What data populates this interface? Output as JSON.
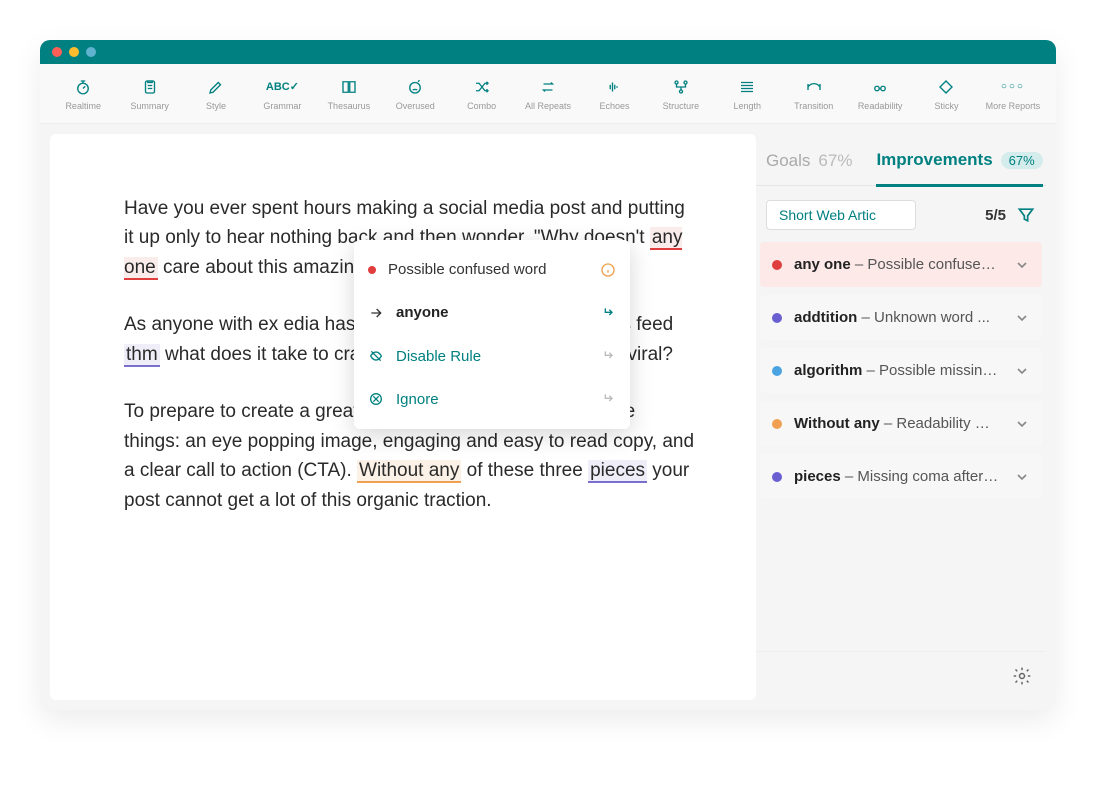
{
  "toolbar": [
    {
      "label": "Realtime"
    },
    {
      "label": "Summary"
    },
    {
      "label": "Style"
    },
    {
      "label": "Grammar"
    },
    {
      "label": "Thesaurus"
    },
    {
      "label": "Overused"
    },
    {
      "label": "Combo"
    },
    {
      "label": "All Repeats"
    },
    {
      "label": "Echoes"
    },
    {
      "label": "Structure"
    },
    {
      "label": "Length"
    },
    {
      "label": "Transition"
    },
    {
      "label": "Readability"
    },
    {
      "label": "Sticky"
    },
    {
      "label": "More Reports"
    }
  ],
  "editor": {
    "p1_a": "Have you ever spent hours making a social media post and putting it up only to hear nothing back and then wonder, \"Why doesn't ",
    "p1_u": "any one",
    "p1_b": " care about this amazing post?\"",
    "p2_a": "As anyone with ex",
    "p2_b": "                                    edia has an algorithm f                                  tent on your news feed                                    ",
    "p2_u": "thm",
    "p2_c": " what does it take to craft a social media post that goes viral?",
    "p3_a": "To prepare to create a great post, you need to focus on three things: an eye popping image, engaging and easy to read copy, and a clear call to action (CTA). ",
    "p3_u1": "Without any",
    "p3_b": " of these three ",
    "p3_u2": "pieces",
    "p3_c": " your post cannot get a lot of this organic traction."
  },
  "popover": {
    "title": "Possible confused word",
    "suggestion": "anyone",
    "disable": "Disable Rule",
    "ignore": "Ignore"
  },
  "sidebar": {
    "tabs": {
      "goals": "Goals",
      "goals_pct": "67%",
      "improvements": "Improvements",
      "improvements_pct": "67%"
    },
    "filter": "Short Web Artic",
    "count": "5/5",
    "issues": [
      {
        "color": "red",
        "word": "any one",
        "desc": "Possible confused ..."
      },
      {
        "color": "purple",
        "word": "addtition",
        "desc": "Unknown word ..."
      },
      {
        "color": "blue",
        "word": "algorithm",
        "desc": "Possible missing ..."
      },
      {
        "color": "orange",
        "word": "Without any",
        "desc": "Readability ma..."
      },
      {
        "color": "purple",
        "word": "pieces",
        "desc": "Missing coma after p..."
      }
    ]
  }
}
